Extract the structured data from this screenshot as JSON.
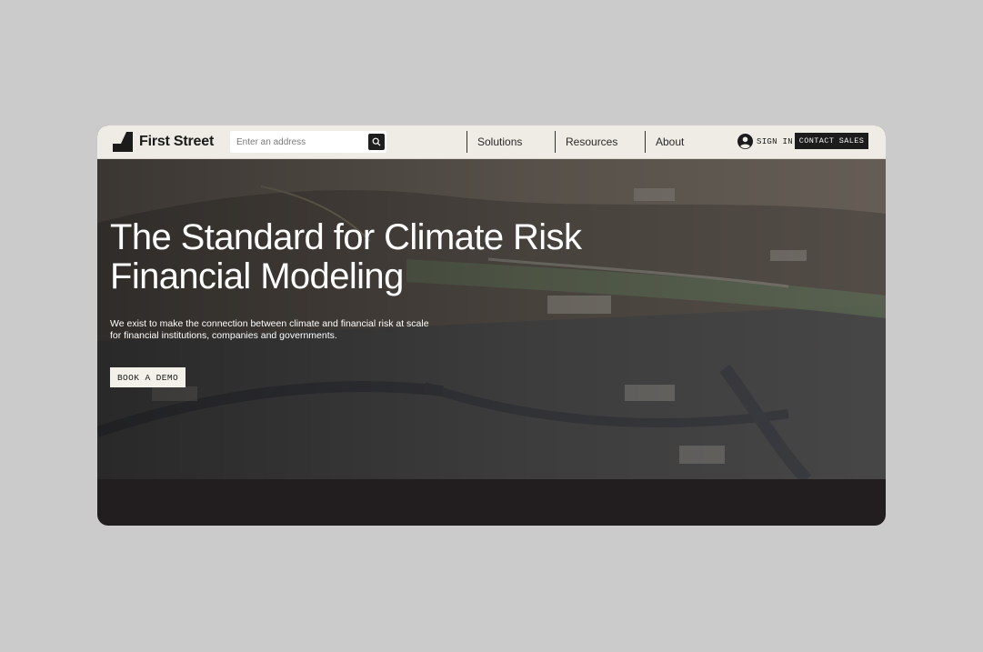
{
  "nav": {
    "brand": "First Street",
    "search": {
      "placeholder": "Enter an address"
    },
    "links": [
      "Solutions",
      "Resources",
      "About"
    ],
    "sign_in": "SIGN IN",
    "contact_sales": "CONTACT SALES"
  },
  "hero": {
    "title_line1": "The Standard for Climate Risk",
    "title_line2": "Financial Modeling",
    "subtitle": "We exist to make the connection between climate and financial risk at scale for financial institutions, companies and governments.",
    "cta": "BOOK A DEMO"
  },
  "colors": {
    "page_background": "#cbcbcb",
    "nav_background": "#efece5",
    "dark_button": "#1c1c1c",
    "footer_band": "#221e1f",
    "light_button": "#f4f1ea"
  },
  "icons": {
    "logo": "first-street-logo-mark",
    "search": "search-icon",
    "account": "user-circle-icon"
  }
}
